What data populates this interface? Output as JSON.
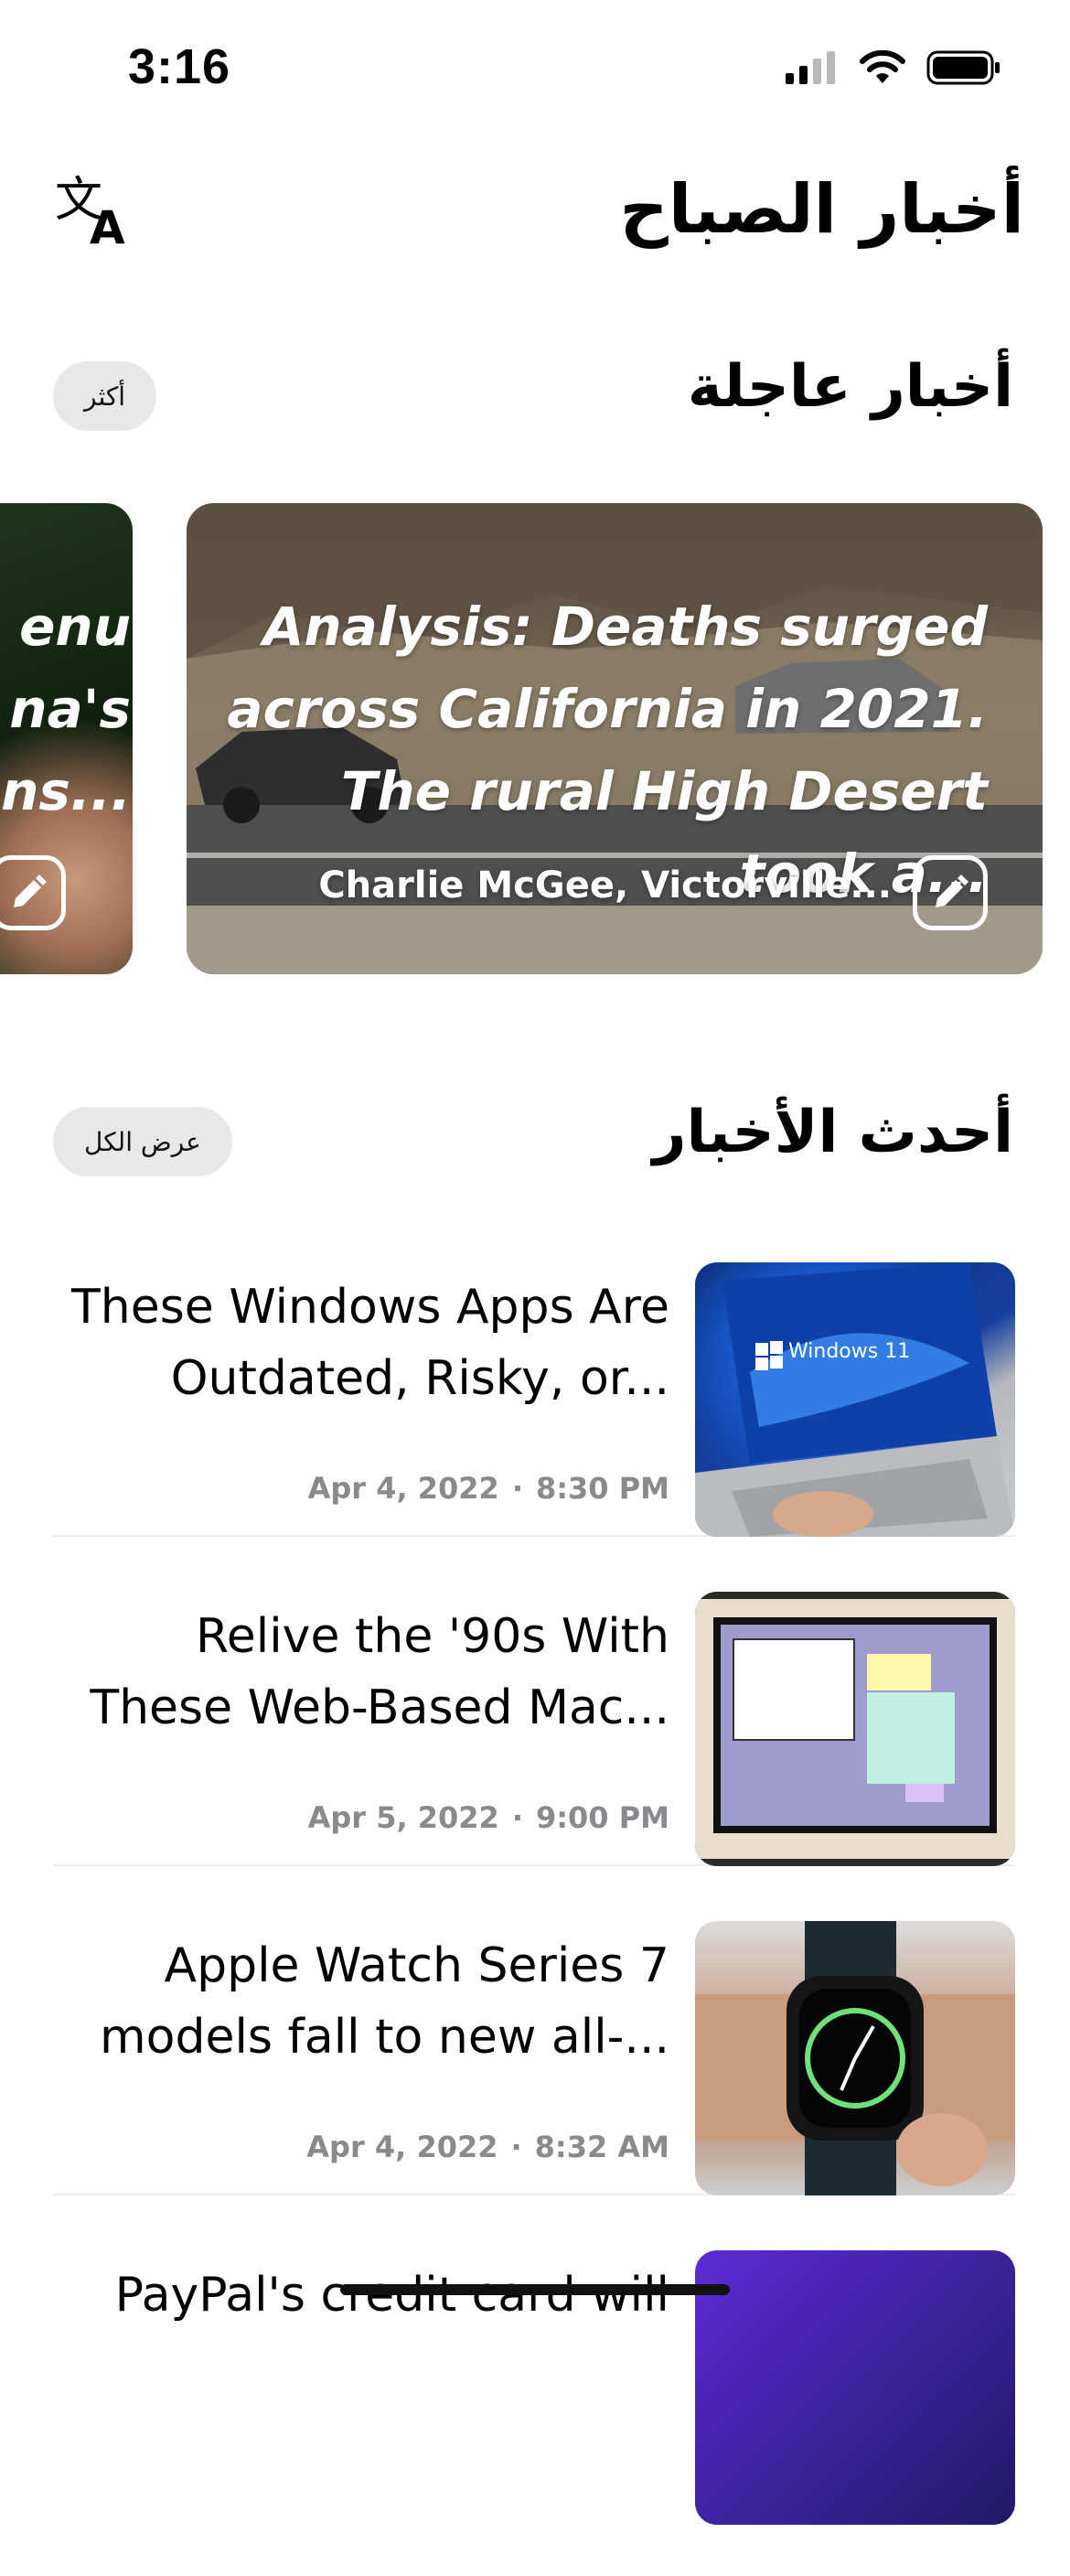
{
  "status_bar": {
    "time": "3:16"
  },
  "header": {
    "title": "أخبار الصباح",
    "translate_icon": "translate-icon"
  },
  "breaking": {
    "title": "أخبار عاجلة",
    "more_label": "أكثر",
    "cards": [
      {
        "headline": "Analysis: Deaths surged across California in 2021. The rural High Desert took a...",
        "source": "Charlie McGee, Victorville..."
      },
      {
        "headline_lines": [
          "enu",
          "na's",
          "ns..."
        ]
      }
    ]
  },
  "latest": {
    "title": "أحدث الأخبار",
    "view_all_label": "عرض الكل",
    "items": [
      {
        "headline": "These Windows Apps Are Outdated, Risky, or...",
        "date": "Apr 4, 2022",
        "time": "8:30 PM",
        "thumb_text": "Windows 11"
      },
      {
        "headline": "Relive the '90s With These Web-Based Mac...",
        "date": "Apr 5, 2022",
        "time": "9:00 PM"
      },
      {
        "headline": "Apple Watch Series 7 models fall to new all-...",
        "date": "Apr 4, 2022",
        "time": "8:32 AM"
      },
      {
        "headline": "PayPal's credit card will"
      }
    ]
  }
}
